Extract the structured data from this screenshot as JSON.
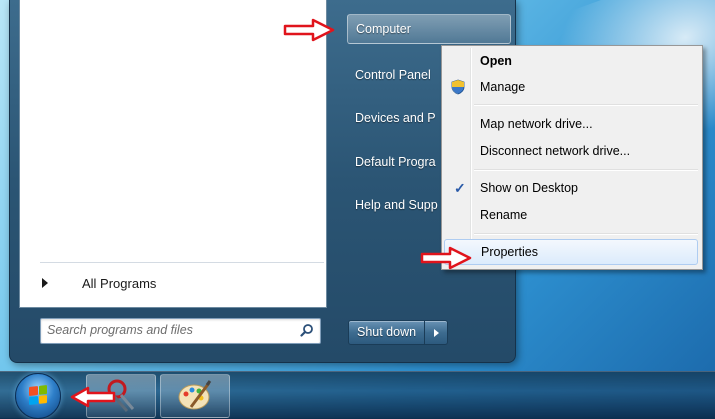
{
  "start_menu": {
    "all_programs_label": "All Programs",
    "search_placeholder": "Search programs and files",
    "right_items": [
      {
        "label": "Computer"
      },
      {
        "label": "Control Panel"
      },
      {
        "label": "Devices and P"
      },
      {
        "label": "Default Progra"
      },
      {
        "label": "Help and Supp"
      }
    ],
    "shutdown_label": "Shut down"
  },
  "context_menu": {
    "items": [
      {
        "label": "Open"
      },
      {
        "label": "Manage"
      },
      {
        "label": "Map network drive..."
      },
      {
        "label": "Disconnect network drive..."
      },
      {
        "label": "Show on Desktop"
      },
      {
        "label": "Rename"
      },
      {
        "label": "Properties"
      }
    ]
  },
  "colors": {
    "annotation_arrow": "#e0141c",
    "start_menu_right": "#2b5574",
    "highlight": "#dcebfc"
  },
  "icons": [
    "search-icon",
    "shield-icon",
    "checkmark-icon",
    "windows-logo-icon",
    "arrow-right-icon"
  ]
}
